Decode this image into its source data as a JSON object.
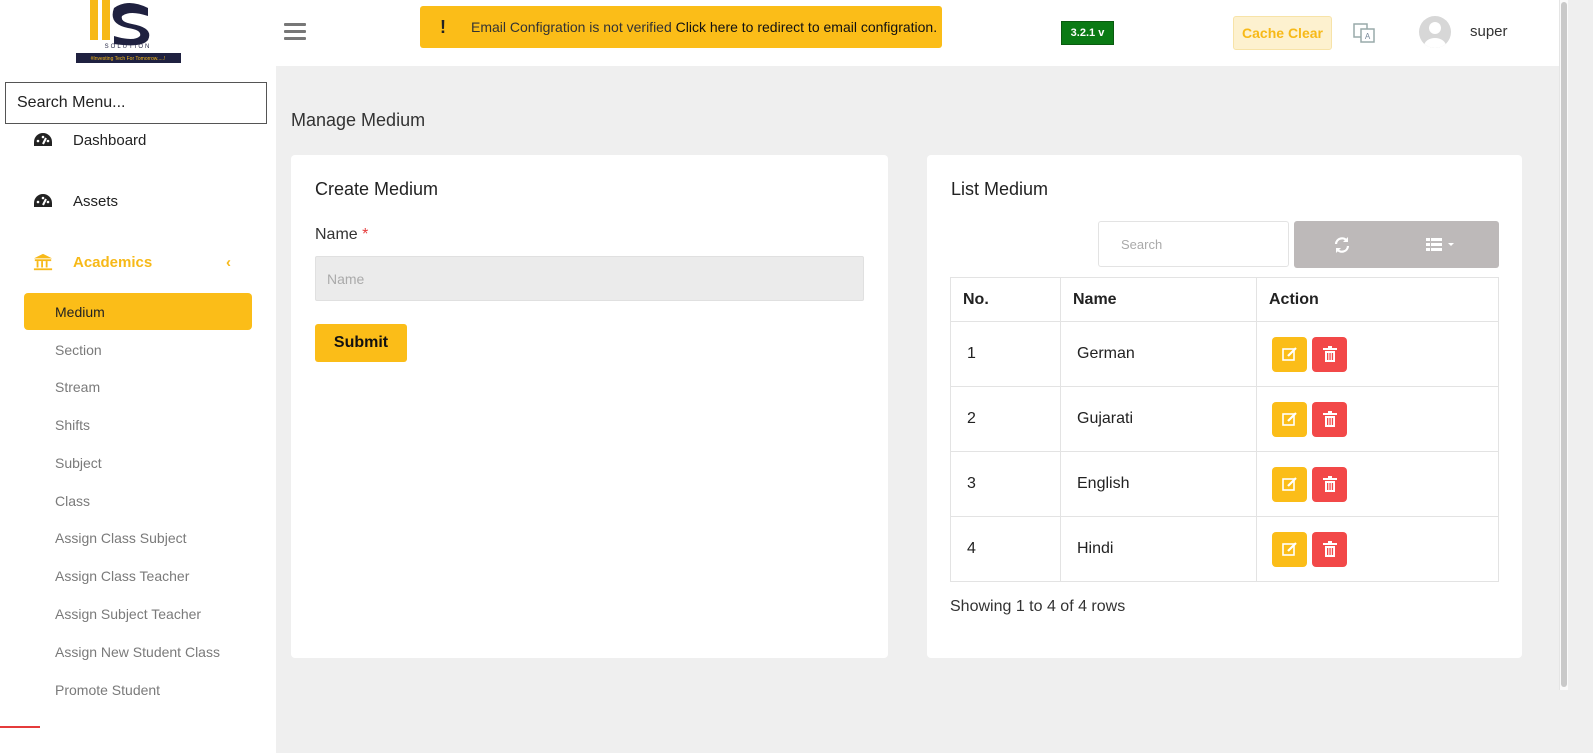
{
  "brand": {
    "logo_text": "SOLUTION",
    "tagline": "#Investing Tech For Tomorrow.....!"
  },
  "sidebar": {
    "search_placeholder": "Search Menu...",
    "items": [
      {
        "label": "Dashboard"
      },
      {
        "label": "Assets"
      },
      {
        "label": "Academics"
      }
    ],
    "academics_sub": [
      "Medium",
      "Section",
      "Stream",
      "Shifts",
      "Subject",
      "Class",
      "Assign Class Subject",
      "Assign Class Teacher",
      "Assign Subject Teacher",
      "Assign New Student Class",
      "Promote Student"
    ]
  },
  "topbar": {
    "alert_text": "Email Configration is not verified",
    "alert_link": "Click here to redirect to email configration.",
    "version": "3.2.1 v",
    "cache_clear": "Cache Clear",
    "username": "super"
  },
  "page_title": "Manage Medium",
  "create": {
    "title": "Create Medium",
    "name_label": "Name",
    "required_mark": "*",
    "name_placeholder": "Name",
    "submit_label": "Submit"
  },
  "list": {
    "title": "List Medium",
    "search_placeholder": "Search",
    "columns": [
      "No.",
      "Name",
      "Action"
    ],
    "rows": [
      {
        "no": "1",
        "name": "German"
      },
      {
        "no": "2",
        "name": "Gujarati"
      },
      {
        "no": "3",
        "name": "English"
      },
      {
        "no": "4",
        "name": "Hindi"
      }
    ],
    "showing": "Showing 1 to 4 of 4 rows"
  },
  "colors": {
    "accent": "#fbbd18",
    "danger": "#f24848",
    "version_bg": "#0a7a14"
  }
}
